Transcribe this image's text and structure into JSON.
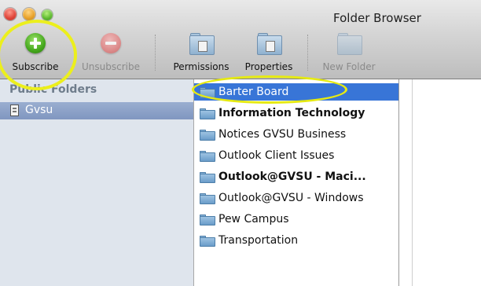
{
  "window": {
    "title": "Folder Browser"
  },
  "toolbar": {
    "subscribe": "Subscribe",
    "unsubscribe": "Unsubscribe",
    "permissions": "Permissions",
    "properties": "Properties",
    "new_folder": "New Folder"
  },
  "sidebar": {
    "header": "Public Folders",
    "items": [
      {
        "label": "Gvsu",
        "icon": "server-icon",
        "selected": true
      }
    ]
  },
  "folders": {
    "items": [
      {
        "label": "Barter Board",
        "selected": true,
        "bold": false
      },
      {
        "label": "Information Technology",
        "selected": false,
        "bold": true
      },
      {
        "label": "Notices GVSU Business",
        "selected": false,
        "bold": false
      },
      {
        "label": "Outlook Client Issues",
        "selected": false,
        "bold": false
      },
      {
        "label": "Outlook@GVSU - Maci...",
        "selected": false,
        "bold": true
      },
      {
        "label": "Outlook@GVSU - Windows",
        "selected": false,
        "bold": false
      },
      {
        "label": "Pew Campus",
        "selected": false,
        "bold": false
      },
      {
        "label": "Transportation",
        "selected": false,
        "bold": false
      }
    ]
  },
  "colors": {
    "selection": "#3875d7",
    "highlight_ring": "#ecef1c",
    "sidebar_bg": "#dfe5ed"
  }
}
